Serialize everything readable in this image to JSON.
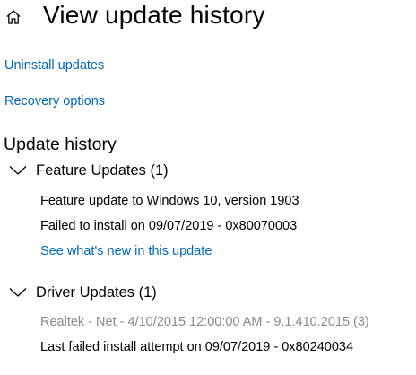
{
  "header": {
    "icon": "home-icon",
    "title": "View update history"
  },
  "links": {
    "uninstall": "Uninstall updates",
    "recovery": "Recovery options"
  },
  "history": {
    "title": "Update history",
    "categories": [
      {
        "label": "Feature Updates (1)",
        "icon": "chevron-down-icon",
        "items": [
          {
            "title": "Feature update to Windows 10, version 1903",
            "status": "Failed to install on 09/07/2019 - 0x80070003",
            "link": "See what's new in this update"
          }
        ]
      },
      {
        "label": "Driver Updates (1)",
        "icon": "chevron-down-icon",
        "items": [
          {
            "title": "Realtek - Net - 4/10/2015 12:00:00 AM - 9.1.410.2015 (3)",
            "status": "Last failed install attempt on 09/07/2019 - 0x80240034"
          }
        ]
      }
    ]
  },
  "colors": {
    "link": "#0067b8",
    "text": "#000000",
    "muted": "#8a8a8a",
    "background": "#ffffff"
  }
}
